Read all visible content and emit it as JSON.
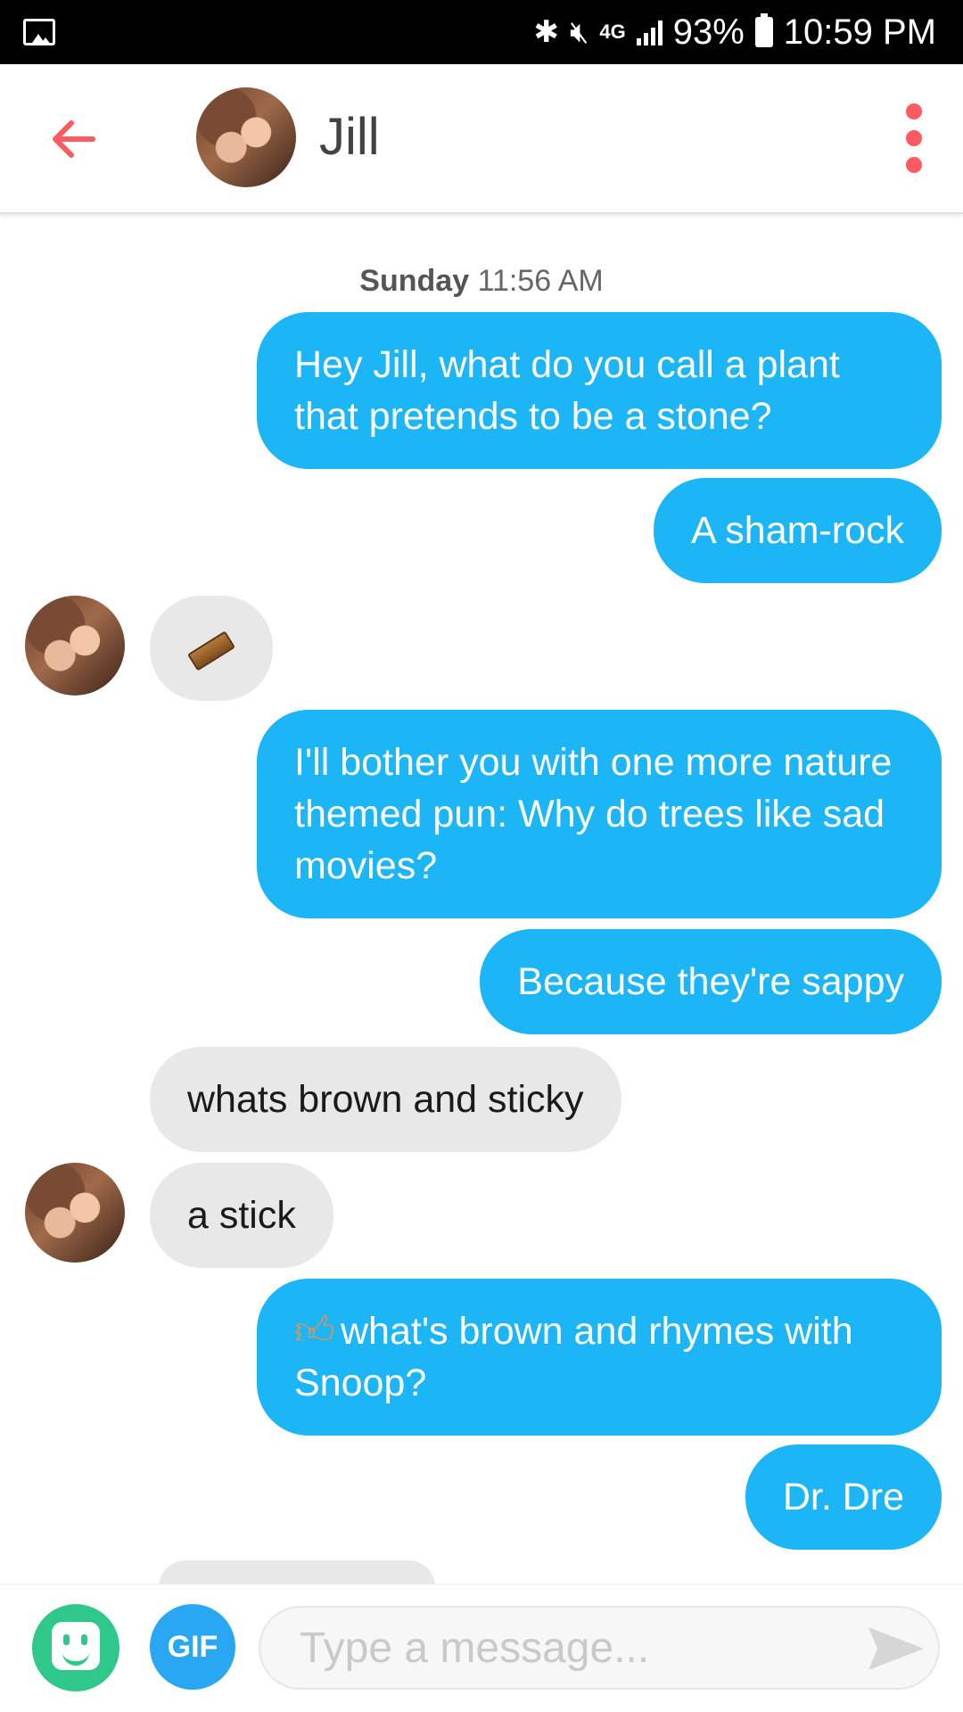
{
  "status_bar": {
    "network": "4G",
    "battery": "93%",
    "time": "10:59 PM",
    "icons": [
      "gallery-icon",
      "bluetooth-icon",
      "mute-icon",
      "signal-icon",
      "battery-icon"
    ]
  },
  "header": {
    "contact_name": "Jill",
    "back_icon": "arrow-left-icon",
    "menu_icon": "more-vert-icon"
  },
  "chat": {
    "timestamp_day": "Sunday",
    "timestamp_time": "11:56 AM",
    "messages": [
      {
        "from": "me",
        "text": "Hey Jill, what do you call a plant that pretends to be a stone?"
      },
      {
        "from": "me",
        "text": "A sham-rock"
      },
      {
        "from": "them",
        "emoji": "coffin-icon"
      },
      {
        "from": "me",
        "text": "I'll bother you with one more nature themed pun: Why do trees like sad movies?"
      },
      {
        "from": "me",
        "text": "Because they're sappy"
      },
      {
        "from": "them",
        "text": "whats brown and sticky"
      },
      {
        "from": "them",
        "text": "a stick"
      },
      {
        "from": "me",
        "emoji": "thumbs-up-icon",
        "text": "what's brown and rhymes with Snoop?"
      },
      {
        "from": "me",
        "text": "Dr. Dre"
      }
    ]
  },
  "composer": {
    "gif_label": "GIF",
    "placeholder": "Type a message...",
    "value": ""
  },
  "colors": {
    "accent": "#fd5b61",
    "outgoing_bubble": "#1cb5f5",
    "incoming_bubble": "#e8e8e8",
    "sticker_button": "#2ec98a",
    "gif_button": "#2aa7f3"
  }
}
